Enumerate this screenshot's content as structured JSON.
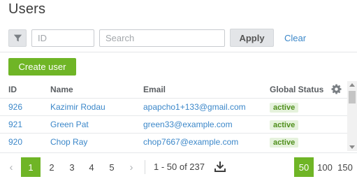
{
  "page": {
    "title": "Users"
  },
  "filters": {
    "id_placeholder": "ID",
    "search_placeholder": "Search",
    "apply_label": "Apply",
    "clear_label": "Clear",
    "filter_icon": "filter-funnel-icon"
  },
  "toolbar": {
    "create_user_label": "Create user"
  },
  "table": {
    "headers": {
      "id": "ID",
      "name": "Name",
      "email": "Email",
      "status": "Global Status"
    },
    "settings_icon": "gear-icon",
    "rows": [
      {
        "id": "926",
        "name": "Kazimir Rodau",
        "email": "apapcho1+133@gmail.com",
        "status": "active"
      },
      {
        "id": "921",
        "name": "Green Pat",
        "email": "green33@example.com",
        "status": "active"
      },
      {
        "id": "920",
        "name": "Chop Ray",
        "email": "chop7667@example.com",
        "status": "active"
      }
    ]
  },
  "pagination": {
    "prev": "‹",
    "next": "›",
    "pages": [
      "1",
      "2",
      "3",
      "4",
      "5"
    ],
    "current_page": "1",
    "range_text": "1 - 50 of 237",
    "download_icon": "download-icon",
    "page_sizes": [
      "50",
      "100",
      "150"
    ],
    "current_page_size": "50"
  },
  "colors": {
    "accent_green": "#6fb526",
    "link_blue": "#3b87c9",
    "badge_bg": "#e5f2dc"
  }
}
